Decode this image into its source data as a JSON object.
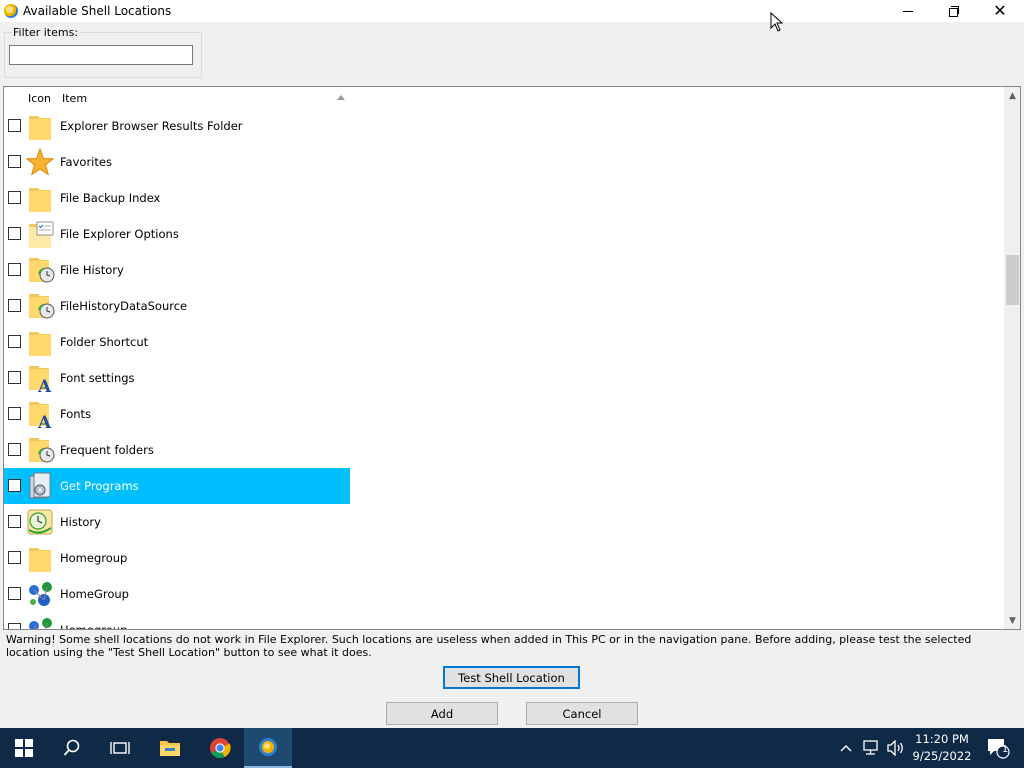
{
  "window": {
    "title": "Available Shell Locations"
  },
  "filter": {
    "label": "Filter items:",
    "value": "",
    "placeholder": ""
  },
  "list": {
    "columns": [
      "Icon",
      "Item"
    ],
    "sort_column": "Item",
    "sort_direction": "ascending",
    "selected_color": "#00bfff",
    "rows": [
      {
        "label": "Explorer Browser Results Folder",
        "icon": "folder-icon",
        "checked": false,
        "selected": false
      },
      {
        "label": "Favorites",
        "icon": "star-icon",
        "checked": false,
        "selected": false
      },
      {
        "label": "File Backup Index",
        "icon": "folder-icon",
        "checked": false,
        "selected": false
      },
      {
        "label": "File Explorer Options",
        "icon": "folder-options-icon",
        "checked": false,
        "selected": false
      },
      {
        "label": "File History",
        "icon": "folder-clock-icon",
        "checked": false,
        "selected": false
      },
      {
        "label": "FileHistoryDataSource",
        "icon": "folder-clock-icon",
        "checked": false,
        "selected": false
      },
      {
        "label": "Folder Shortcut",
        "icon": "folder-icon",
        "checked": false,
        "selected": false
      },
      {
        "label": "Font settings",
        "icon": "folder-font-icon",
        "checked": false,
        "selected": false
      },
      {
        "label": "Fonts",
        "icon": "folder-font-icon",
        "checked": false,
        "selected": false
      },
      {
        "label": "Frequent folders",
        "icon": "folder-clock-icon",
        "checked": false,
        "selected": false
      },
      {
        "label": "Get Programs",
        "icon": "programs-icon",
        "checked": false,
        "selected": true
      },
      {
        "label": "History",
        "icon": "history-icon",
        "checked": false,
        "selected": false
      },
      {
        "label": "Homegroup",
        "icon": "folder-icon",
        "checked": false,
        "selected": false
      },
      {
        "label": "HomeGroup",
        "icon": "homegroup-icon",
        "checked": false,
        "selected": false
      },
      {
        "label": "Homegroup",
        "icon": "homegroup-icon",
        "checked": false,
        "selected": false
      }
    ]
  },
  "scrollbar": {
    "position": 0.33
  },
  "warning": "Warning! Some shell locations do not work in File Explorer. Such locations are useless when added in This PC or in the navigation pane. Before adding, please test the selected location using the \"Test Shell Location\" button to see what it does.",
  "buttons": {
    "test": "Test Shell Location",
    "add": "Add",
    "cancel": "Cancel"
  },
  "taskbar": {
    "time": "11:20 PM",
    "date": "9/25/2022",
    "notification_count": "1"
  }
}
